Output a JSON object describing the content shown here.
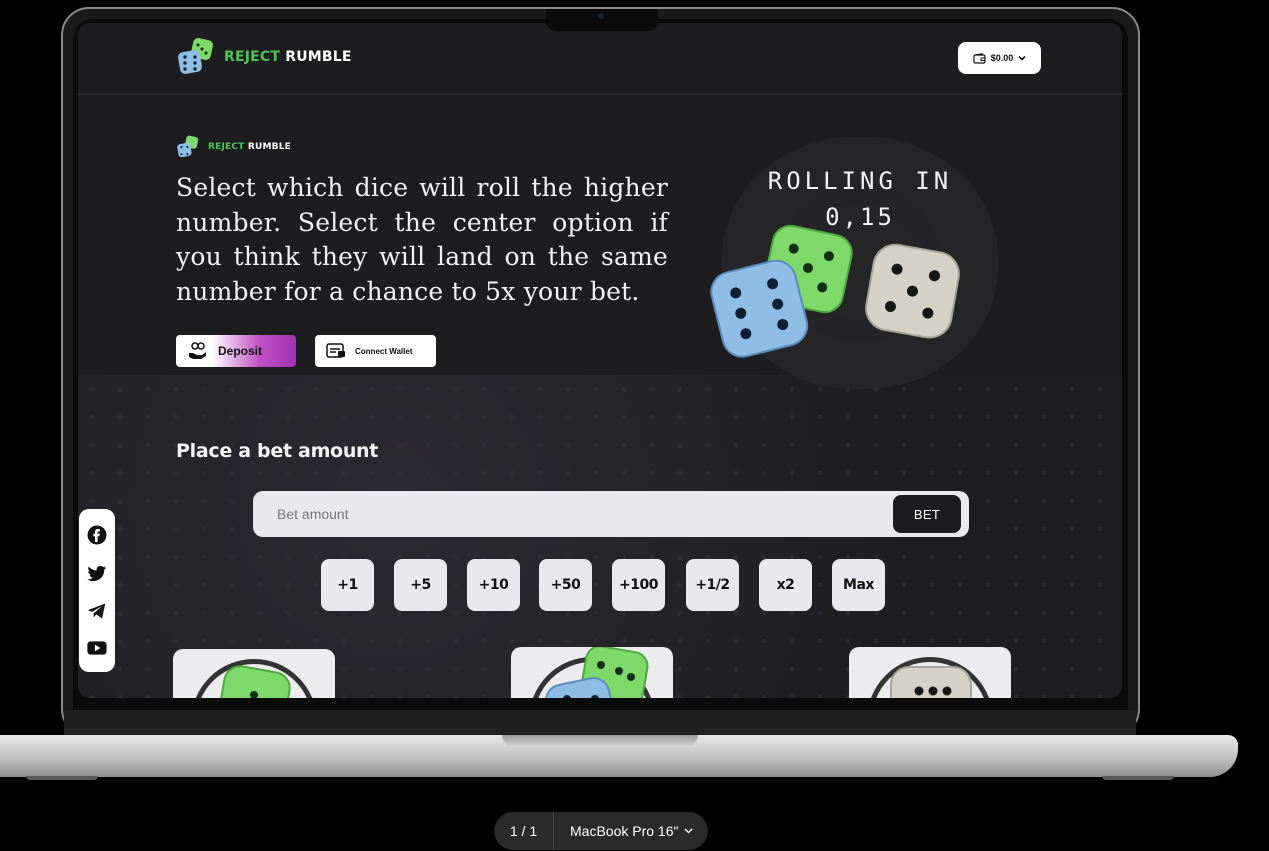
{
  "header": {
    "brand_green": "REJECT",
    "brand_white": "RUMBLE",
    "balance": "$0.00"
  },
  "hero": {
    "brand_green": "REJECT",
    "brand_white": "RUMBLE",
    "description": "Select which dice will roll the higher number. Select the center option if you think they will land on the same number for a chance to 5x your bet.",
    "deposit_label": "Deposit",
    "connect_wallet_label": "Connect Wallet"
  },
  "roll": {
    "label": "ROLLING IN",
    "countdown": "0,15"
  },
  "bet": {
    "title": "Place a bet amount",
    "placeholder": "Bet amount",
    "button_label": "BET",
    "quick_amounts": [
      "+1",
      "+5",
      "+10",
      "+50",
      "+100",
      "+1/2",
      "x2",
      "Max"
    ]
  },
  "social": [
    "facebook-icon",
    "twitter-icon",
    "telegram-icon",
    "youtube-icon"
  ],
  "device_bar": {
    "page_count": "1 / 1",
    "device_name": "MacBook Pro 16\""
  },
  "colors": {
    "brand_green": "#4cc45a",
    "dice_green": "#7fd86a",
    "dice_blue": "#8fbde6",
    "dice_grey": "#d4d2c6",
    "deposit_gradient_end": "#a033b0",
    "page_bg": "#1d1d1f"
  }
}
